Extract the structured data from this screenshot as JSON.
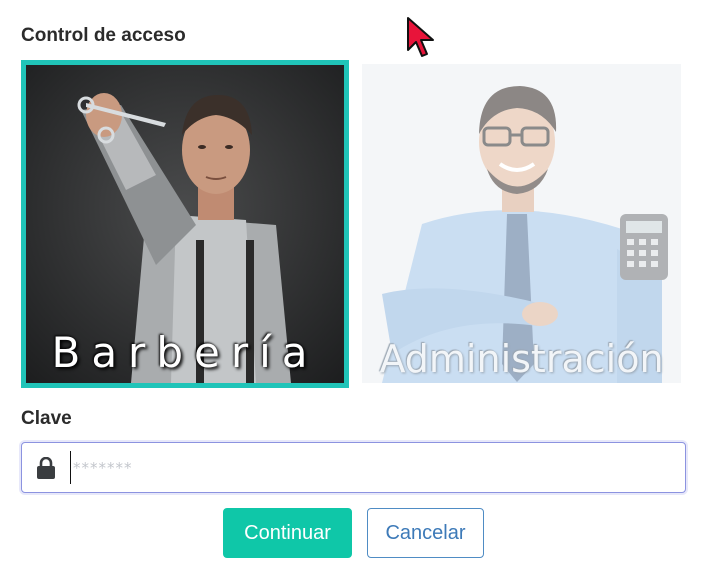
{
  "access": {
    "title": "Control de acceso"
  },
  "roles": [
    {
      "label": "Barbería",
      "selected": true
    },
    {
      "label": "Administración",
      "selected": false
    }
  ],
  "password": {
    "label": "Clave",
    "placeholder": "*******",
    "value": ""
  },
  "actions": {
    "continue_label": "Continuar",
    "cancel_label": "Cancelar"
  },
  "colors": {
    "accent": "#20c4b8",
    "continue_button": "#0fc7a8",
    "cancel_border": "#4f8cc4"
  }
}
